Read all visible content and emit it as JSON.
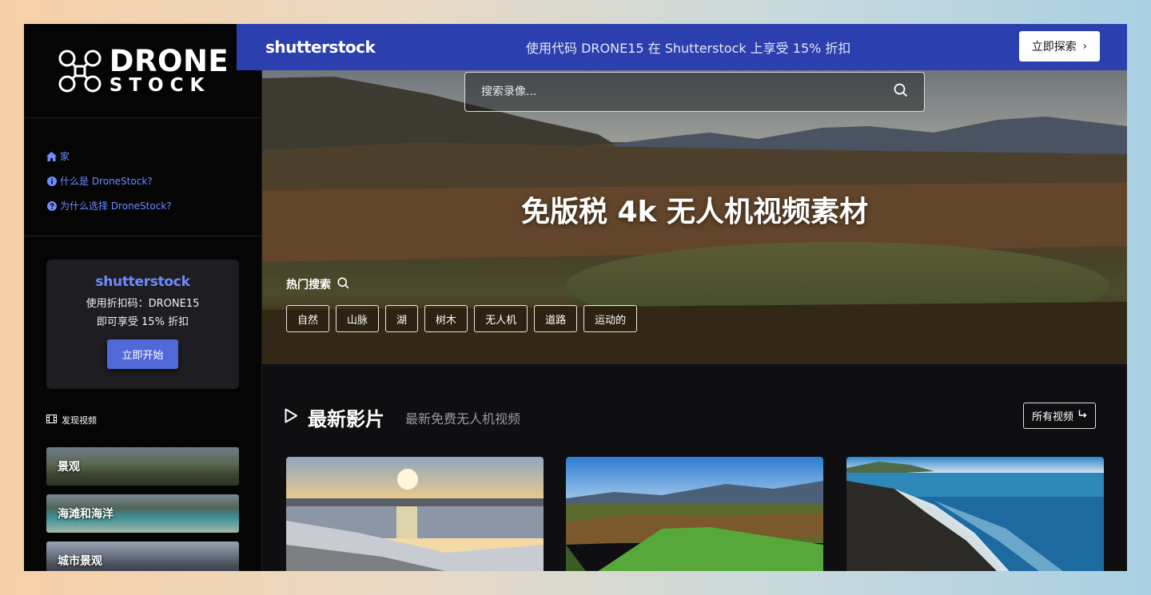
{
  "brand": {
    "line1": "DRONE",
    "line2": "STOCK"
  },
  "nav": {
    "items": [
      {
        "label": "家",
        "icon": "home-icon"
      },
      {
        "label": "什么是 DroneStock?",
        "icon": "info-icon"
      },
      {
        "label": "为什么选择 DroneStock?",
        "icon": "help-icon"
      }
    ]
  },
  "promo": {
    "brand": "shutterstock",
    "line1": "使用折扣码：DRONE15",
    "line2": "即可享受 15% 折扣",
    "button": "立即开始"
  },
  "discover": {
    "label": "发现视频"
  },
  "categories": [
    "景观",
    "海滩和海洋",
    "城市景观"
  ],
  "banner": {
    "brand": "shutterstock",
    "message": "使用代码 DRONE15 在 Shutterstock 上享受 15% 折扣",
    "button": "立即探索"
  },
  "hero": {
    "search_placeholder": "搜索录像...",
    "title": "免版税 4k 无人机视频素材",
    "hot_label": "热门搜索",
    "tags": [
      "自然",
      "山脉",
      "湖",
      "树木",
      "无人机",
      "道路",
      "运动的"
    ]
  },
  "latest": {
    "title": "最新影片",
    "subtitle": "最新免费无人机视频",
    "all_button": "所有视频"
  },
  "colors": {
    "accent": "#6e8cff",
    "banner": "#2c3fae",
    "button": "#5068d8"
  }
}
